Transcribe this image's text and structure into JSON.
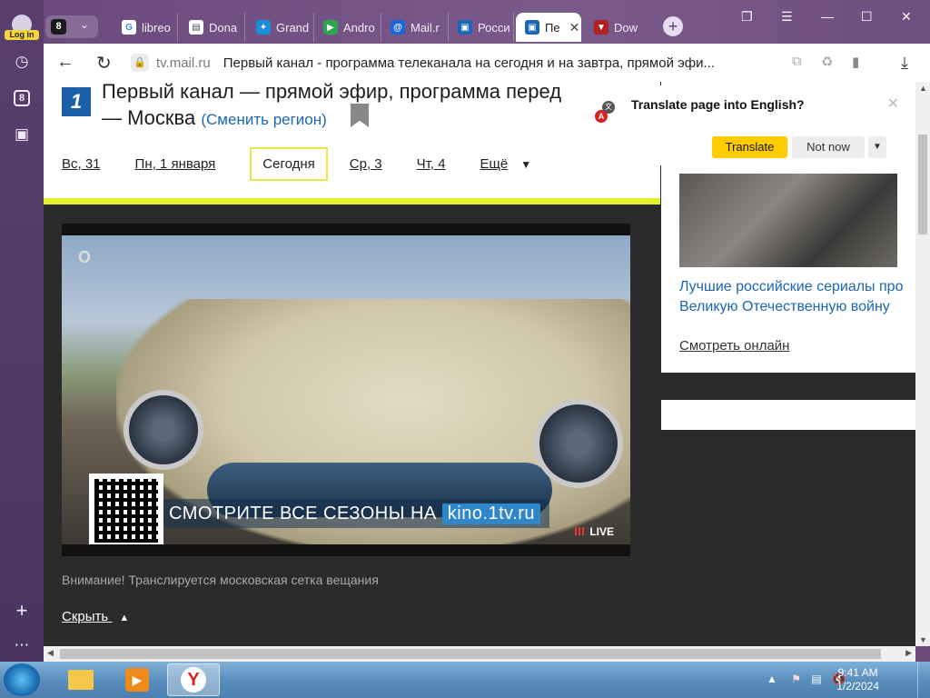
{
  "sidebar": {
    "login_label": "Log in",
    "tabs_count": "8"
  },
  "tabstrip": {
    "tab_count": "8",
    "tabs": [
      {
        "label": "libreo",
        "favicon": "G",
        "color": "#ffffff"
      },
      {
        "label": "Dona",
        "favicon": "doc",
        "color": "#ffffff"
      },
      {
        "label": "Grand",
        "favicon": "grand",
        "color": "#1a8fd8"
      },
      {
        "label": "Andro",
        "favicon": "play",
        "color": "#2ea44f"
      },
      {
        "label": "Mail.r",
        "favicon": "@",
        "color": "#1a66d8"
      },
      {
        "label": "Росси",
        "favicon": "tv",
        "color": "#1a66b3"
      },
      {
        "label": "Пе",
        "favicon": "tv",
        "color": "#1a66b3"
      },
      {
        "label": "Dow",
        "favicon": "dl",
        "color": "#b22020"
      }
    ]
  },
  "addressbar": {
    "domain": "tv.mail.ru",
    "title": "Первый канал - программа телеканала на сегодня и на завтра, прямой эфи..."
  },
  "header": {
    "logo": "1",
    "title_line1": "Первый канал — прямой эфир, программа перед",
    "title_line2": "— Москва",
    "change_region": "(Сменить регион)"
  },
  "days": [
    "Вс, 31",
    "Пн, 1 января",
    "Сегодня",
    "Ср, 3",
    "Чт, 4",
    "Ещё"
  ],
  "video": {
    "promo_text": "СМОТРИТЕ ВСЕ СЕЗОНЫ НА",
    "promo_site": "kino.1tv.ru",
    "live": "LIVE"
  },
  "notice": "Внимание! Транслируется московская сетка вещания",
  "hide_label": "Скрыть",
  "sidecard": {
    "title": "Лучшие российские сериалы про Великую Отечественную войну",
    "watch": "Смотреть онлайн"
  },
  "translate_popup": {
    "question": "Translate page into English?",
    "translate": "Translate",
    "not_now": "Not now"
  },
  "taskbar": {
    "time": "9:41 AM",
    "date": "1/2/2024"
  }
}
